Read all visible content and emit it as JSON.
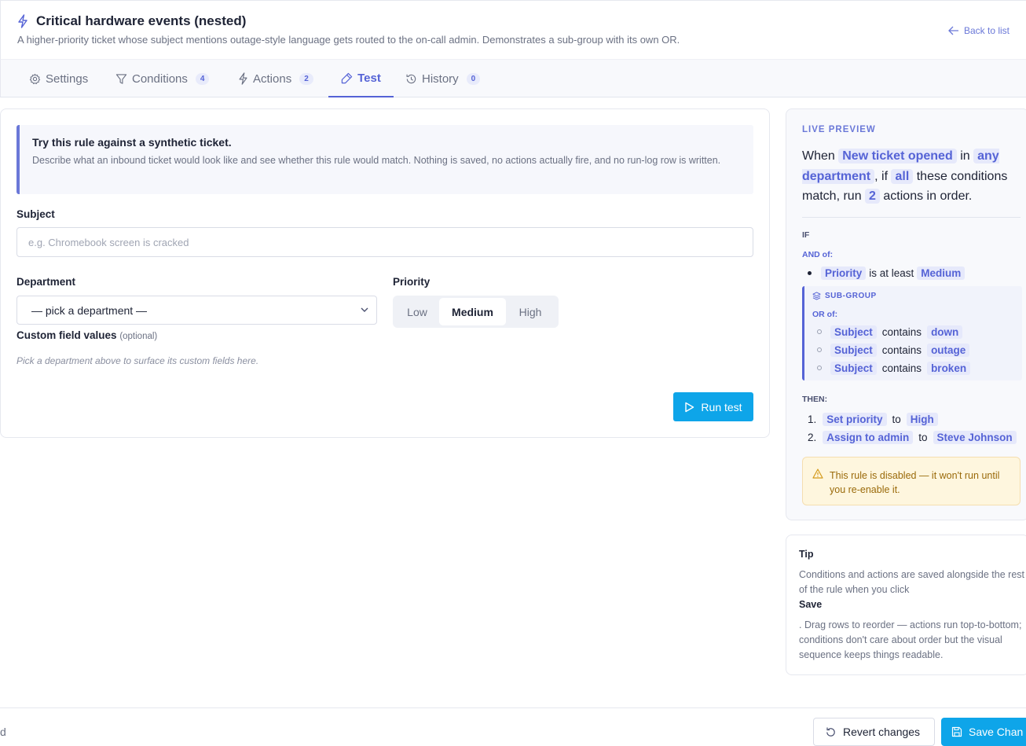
{
  "header": {
    "title": "Critical hardware events (nested)",
    "subtitle": "A higher-priority ticket whose subject mentions outage-style language gets routed to the on-call admin. Demonstrates a sub-group with its own OR.",
    "back_label": "Back to list"
  },
  "tabs": [
    {
      "label": "Settings",
      "icon": "gear-icon",
      "count": null,
      "active": false
    },
    {
      "label": "Conditions",
      "icon": "filter-icon",
      "count": "4",
      "active": false
    },
    {
      "label": "Actions",
      "icon": "lightning-icon",
      "count": "2",
      "active": false
    },
    {
      "label": "Test",
      "icon": "flask-icon",
      "count": null,
      "active": true
    },
    {
      "label": "History",
      "icon": "history-icon",
      "count": "0",
      "active": false
    }
  ],
  "test": {
    "callout_title": "Try this rule against a synthetic ticket.",
    "callout_text": "Describe what an inbound ticket would look like and see whether this rule would match. Nothing is saved, no actions actually fire, and no run-log row is written.",
    "subject_label": "Subject",
    "subject_placeholder": "e.g. Chromebook screen is cracked",
    "department_label": "Department",
    "department_selected": "— pick a department —",
    "priority_label": "Priority",
    "priority_options": [
      "Low",
      "Medium",
      "High"
    ],
    "priority_selected": "Medium",
    "custom_label": "Custom field values",
    "custom_optional": "(optional)",
    "custom_hint": "Pick a department above to surface its custom fields here.",
    "run_label": "Run test"
  },
  "preview": {
    "title": "LIVE PREVIEW",
    "s1": "When",
    "trigger": "New ticket opened",
    "s2": "in",
    "department": "any department",
    "s3": ", if",
    "quantifier": "all",
    "s4": "these conditions match, run",
    "action_count": "2",
    "s5": "actions in order.",
    "if_label": "IF",
    "and_label": "AND of:",
    "cond1": {
      "field": "Priority",
      "op": "is at least",
      "value": "Medium"
    },
    "subgroup_label": "SUB-GROUP",
    "or_label": "OR of:",
    "or_conds": [
      {
        "field": "Subject",
        "op": "contains",
        "value": "down"
      },
      {
        "field": "Subject",
        "op": "contains",
        "value": "outage"
      },
      {
        "field": "Subject",
        "op": "contains",
        "value": "broken"
      }
    ],
    "then_label": "THEN:",
    "actions": [
      {
        "num": "1.",
        "action": "Set priority",
        "op": "to",
        "value": "High"
      },
      {
        "num": "2.",
        "action": "Assign to admin",
        "op": "to",
        "value": "Steve Johnson"
      }
    ],
    "warning": "This rule is disabled — it won't run until you re-enable it."
  },
  "tip": {
    "title": "Tip",
    "text1": "Conditions and actions are saved alongside the rest of the rule when you click",
    "save_word": "Save",
    "text2": ". Drag rows to reorder — actions run top-to-bottom; conditions don't care about order but the visual sequence keeps things readable."
  },
  "footer": {
    "left_text": "d",
    "revert_label": "Revert changes",
    "save_label": "Save Chan"
  },
  "colors": {
    "accent": "#5563d6",
    "primary_button": "#0ea5e9",
    "warning_bg": "#fef6de"
  }
}
